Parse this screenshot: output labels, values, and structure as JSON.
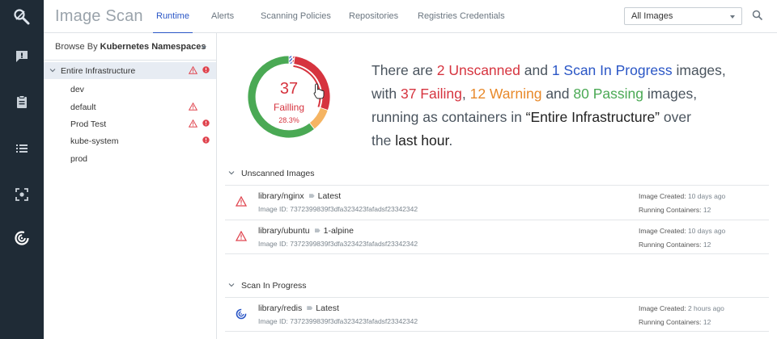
{
  "app": {
    "title": "Image Scan"
  },
  "tabs": [
    {
      "label": "Runtime",
      "active": true
    },
    {
      "label": "Alerts"
    },
    {
      "label": "Scanning Policies"
    },
    {
      "label": "Repositories"
    },
    {
      "label": "Registries Credentials"
    }
  ],
  "image_filter": {
    "selected": "All Images"
  },
  "rail_icons": [
    "logo-icon",
    "comment-icon",
    "clipboard-icon",
    "list-icon",
    "capture-icon",
    "scan-icon"
  ],
  "sidebar": {
    "browse_prefix": "Browse By",
    "browse_value": "Kubernetes Namespaces",
    "tree": [
      {
        "label": "Entire Infrastructure",
        "warn": true,
        "error": true,
        "selected": true,
        "expanded": true
      },
      {
        "label": "dev",
        "warn": false,
        "error": false
      },
      {
        "label": "default",
        "warn": true,
        "error": false
      },
      {
        "label": "Prod Test",
        "warn": true,
        "error": true
      },
      {
        "label": "kube-system",
        "warn": false,
        "error": true
      },
      {
        "label": "prod",
        "warn": false,
        "error": false
      }
    ]
  },
  "donut": {
    "value": "37",
    "label": "Failling",
    "percent": "28.3%",
    "segments": {
      "failing": 37,
      "warning": 12,
      "passing": 80,
      "unscanned": 2,
      "in_progress": 1
    },
    "colors": {
      "failing": "#d6343f",
      "warning": "#f5b462",
      "passing": "#4aa954",
      "unscanned": "#2a56c6"
    }
  },
  "summary": {
    "t1": "There are ",
    "unscanned": "2 Unscanned",
    "t2": " and ",
    "in_progress": "1 Scan In Progress",
    "t3": " images,",
    "t4": "with ",
    "failing": "37 Failing",
    "t5": ", ",
    "warning": "12 Warning",
    "t6": " and ",
    "passing": "80 Passing",
    "t7": " images,",
    "t8": "running as containers in ",
    "scope": "“Entire Infrastructure”",
    "t9": " over",
    "t10": "the ",
    "period": "last hour",
    "t11": "."
  },
  "labels": {
    "image_id": "Image ID: ",
    "image_created": "Image Created: ",
    "running_containers": "Running Containers: "
  },
  "sections": [
    {
      "title": "Unscanned Images",
      "items": [
        {
          "name": "library/nginx",
          "tag": "Latest",
          "image_id": "7372399839f3dfa323423fafadsf23342342",
          "created": "10 days ago",
          "containers": "12"
        },
        {
          "name": "library/ubuntu",
          "tag": "1-alpine",
          "image_id": "7372399839f3dfa323423fafadsf23342342",
          "created": "10 days ago",
          "containers": "12"
        }
      ]
    },
    {
      "title": "Scan In Progress",
      "items": [
        {
          "name": "library/redis",
          "tag": "Latest",
          "image_id": "7372399839f3dfa323423fafadsf23342342",
          "created": "2 hours ago",
          "containers": "12"
        }
      ]
    }
  ]
}
